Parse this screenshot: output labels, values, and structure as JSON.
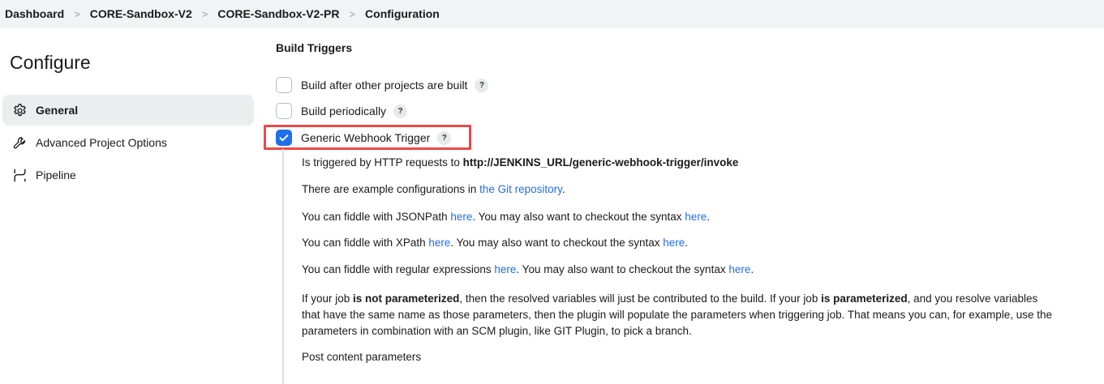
{
  "breadcrumb": {
    "items": [
      "Dashboard",
      "CORE-Sandbox-V2",
      "CORE-Sandbox-V2-PR",
      "Configuration"
    ],
    "separator": ">"
  },
  "sidebar": {
    "title": "Configure",
    "items": [
      {
        "label": "General",
        "icon": "gear-icon",
        "active": true
      },
      {
        "label": "Advanced Project Options",
        "icon": "wrench-icon",
        "active": false
      },
      {
        "label": "Pipeline",
        "icon": "pipeline-icon",
        "active": false
      }
    ]
  },
  "main": {
    "section_title": "Build Triggers",
    "triggers": [
      {
        "label": "Build after other projects are built",
        "checked": false,
        "help": "?"
      },
      {
        "label": "Build periodically",
        "checked": false,
        "help": "?"
      },
      {
        "label": "Generic Webhook Trigger",
        "checked": true,
        "help": "?"
      }
    ],
    "details": {
      "line1_text": "Is triggered by HTTP requests to ",
      "line1_url": "http://JENKINS_URL/generic-webhook-trigger/invoke",
      "line2_text": "There are example configurations in ",
      "line2_link": "the Git repository",
      "line2_end": ".",
      "jsonpath_text": "You can fiddle with JSONPath ",
      "xpath_text": "You can fiddle with XPath ",
      "regex_text": "You can fiddle with regular expressions ",
      "here_link": "here",
      "syntax_text": ". You may also want to checkout the syntax ",
      "period": ".",
      "param_p1": "If your job ",
      "param_b1": "is not parameterized",
      "param_p2": ", then the resolved variables will just be contributed to the build. If your job ",
      "param_b2": "is parameterized",
      "param_p3": ", and you resolve variables that have the same name as those parameters, then the plugin will populate the parameters when triggering job. That means you can, for example, use the parameters in combination with an SCM plugin, like GIT Plugin, to pick a branch.",
      "post_content": "Post content parameters"
    }
  },
  "colors": {
    "accent": "#1f6feb",
    "highlight": "#e84a4a",
    "breadcrumb_bg": "#f2f3f5",
    "active_item_bg": "#ecedef"
  }
}
